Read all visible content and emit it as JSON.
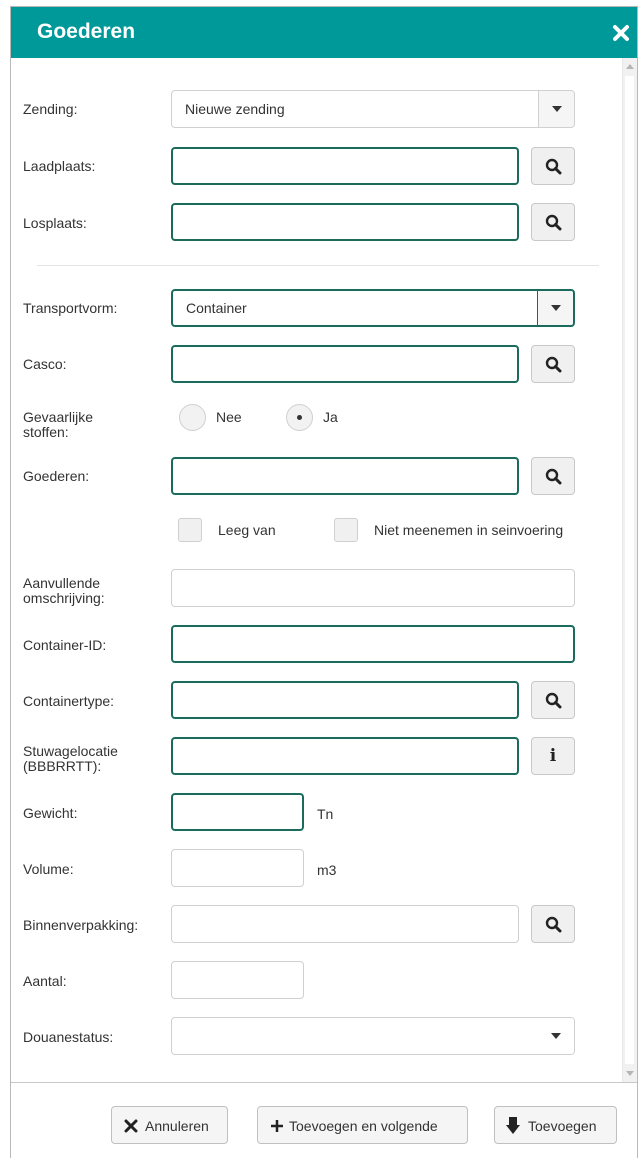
{
  "dialog": {
    "title": "Goederen",
    "close_icon": "close-icon"
  },
  "form": {
    "zending": {
      "label": "Zending:",
      "value": "Nieuwe zending"
    },
    "laadplaats": {
      "label": "Laadplaats:",
      "value": ""
    },
    "losplaats": {
      "label": "Losplaats:",
      "value": ""
    },
    "transportvorm": {
      "label": "Transportvorm:",
      "value": "Container"
    },
    "casco": {
      "label": "Casco:",
      "value": ""
    },
    "gevaarlijke_stoffen": {
      "label_line1": "Gevaarlijke",
      "label_line2": "stoffen:",
      "option_no": "Nee",
      "option_yes": "Ja",
      "selected": "Ja"
    },
    "goederen": {
      "label": "Goederen:",
      "value": ""
    },
    "leeg_van": {
      "label": "Leeg van",
      "checked": false
    },
    "niet_meenemen": {
      "label": "Niet meenemen in seinvoering",
      "checked": false
    },
    "aanvullende_omschrijving": {
      "label_line1": "Aanvullende",
      "label_line2": "omschrijving:",
      "value": ""
    },
    "container_id": {
      "label": "Container-ID:",
      "value": ""
    },
    "containertype": {
      "label": "Containertype:",
      "value": ""
    },
    "stuwagelocatie": {
      "label_line1": "Stuwagelocatie",
      "label_line2": "(BBBRRTT):",
      "value": "",
      "info_icon": "info-icon"
    },
    "gewicht": {
      "label": "Gewicht:",
      "value": "",
      "unit": "Tn"
    },
    "volume": {
      "label": "Volume:",
      "value": "",
      "unit": "m3"
    },
    "binnenverpakking": {
      "label": "Binnenverpakking:",
      "value": ""
    },
    "aantal": {
      "label": "Aantal:",
      "value": ""
    },
    "douanestatus": {
      "label": "Douanestatus:",
      "value": ""
    }
  },
  "footer": {
    "cancel_label": "Annuleren",
    "add_next_label": "Toevoegen en volgende",
    "add_label": "Toevoegen"
  },
  "colors": {
    "header": "#009999",
    "active_border": "#1a6b5c"
  }
}
